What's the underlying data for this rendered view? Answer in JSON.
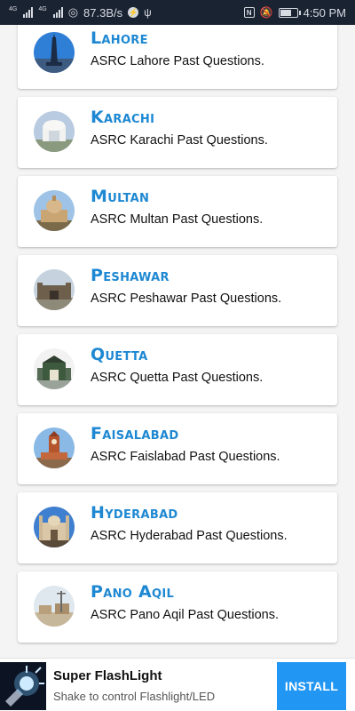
{
  "status_bar": {
    "net_speed": "87.3B/s",
    "sim1_label": "4G",
    "sim2_label": "4G",
    "time": "4:50 PM"
  },
  "cities": [
    {
      "name": "Lahore",
      "subtitle": "ASRC Lahore Past Questions.",
      "icon": "minar-e-pakistan-icon"
    },
    {
      "name": "Karachi",
      "subtitle": "ASRC Karachi Past Questions.",
      "icon": "mazar-e-quaid-icon"
    },
    {
      "name": "Multan",
      "subtitle": "ASRC Multan Past Questions.",
      "icon": "shrine-icon"
    },
    {
      "name": "Peshawar",
      "subtitle": "ASRC Peshawar Past Questions.",
      "icon": "fort-icon"
    },
    {
      "name": "Quetta",
      "subtitle": "ASRC Quetta Past Questions.",
      "icon": "building-icon"
    },
    {
      "name": "Faisalabad",
      "subtitle": "ASRC Faislabad Past Questions.",
      "icon": "clock-tower-icon"
    },
    {
      "name": "Hyderabad",
      "subtitle": "ASRC Hyderabad Past Questions.",
      "icon": "mosque-icon"
    },
    {
      "name": "Pano Aqil",
      "subtitle": "ASRC Pano Aqil Past Questions.",
      "icon": "town-icon"
    }
  ],
  "ad": {
    "title": "Super FlashLight",
    "subtitle": "Shake to control Flashlight/LED",
    "button": "INSTALL",
    "icon": "flashlight-icon"
  },
  "colors": {
    "city_title": "#1e88d2",
    "status_bar_bg": "#1a2332",
    "install_button": "#2196f3"
  }
}
